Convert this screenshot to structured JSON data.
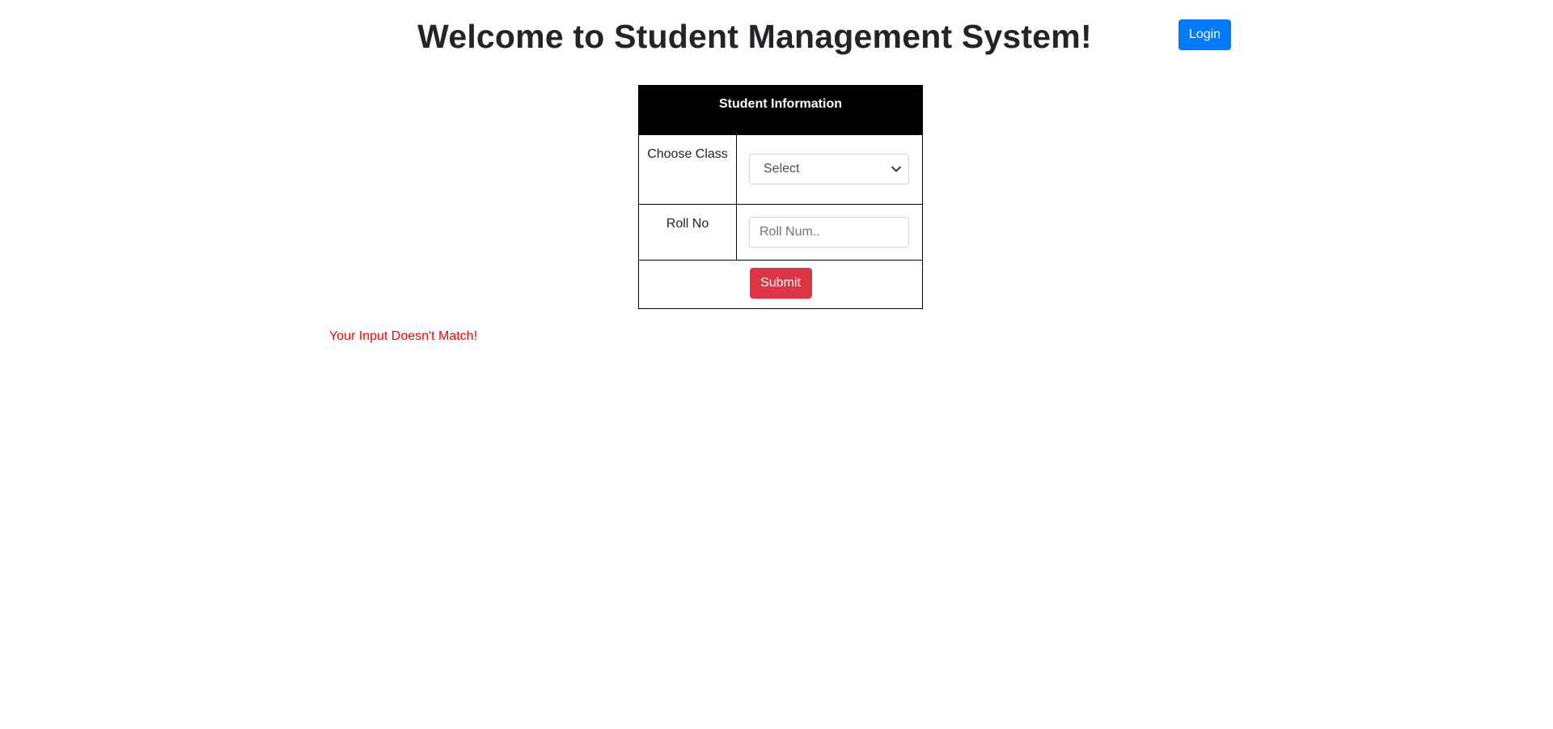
{
  "header": {
    "title": "Welcome to Student Management System!",
    "login_label": "Login"
  },
  "form": {
    "table_heading": "Student Information",
    "class_label": "Choose Class",
    "class_select": {
      "selected": "Select",
      "options": [
        "Select"
      ]
    },
    "roll_label": "Roll No",
    "roll_input": {
      "value": "",
      "placeholder": "Roll Num.."
    },
    "submit_label": "Submit"
  },
  "status": {
    "error_message": "Your Input Doesn't Match!"
  },
  "colors": {
    "primary": "#007bff",
    "danger": "#dc3545",
    "error_text": "#ff0000",
    "table_header_bg": "#000000"
  },
  "icons": {
    "select_arrow": "chevron-down-icon"
  }
}
